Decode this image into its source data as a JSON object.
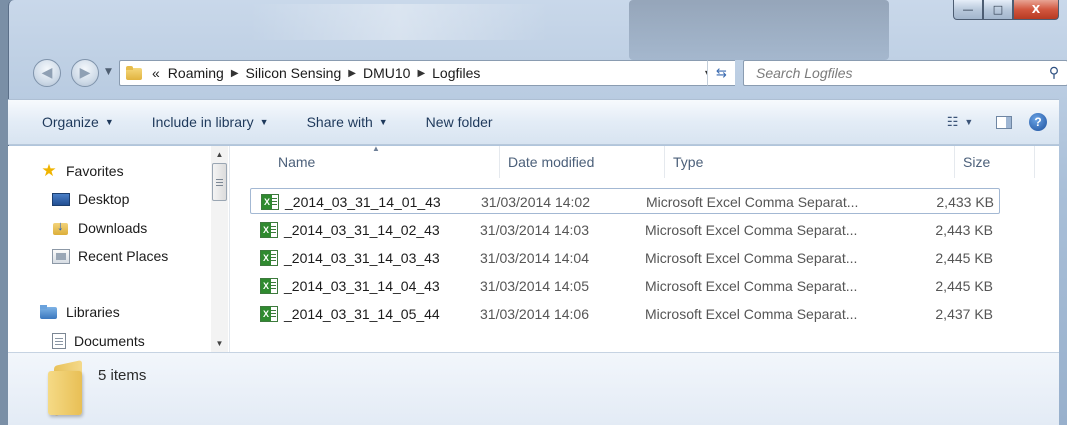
{
  "window": {
    "minimize_glyph": "—",
    "maximize_glyph": "□",
    "close_glyph": "X"
  },
  "address_bar": {
    "overflow_glyph": "«",
    "crumbs": [
      "Roaming",
      "Silicon Sensing",
      "DMU10",
      "Logfiles"
    ],
    "separator_glyph": "▶"
  },
  "search": {
    "placeholder": "Search Logfiles"
  },
  "toolbar": {
    "organize": "Organize",
    "include_in_library": "Include in library",
    "share_with": "Share with",
    "new_folder": "New folder"
  },
  "nav_pane": {
    "favorites": "Favorites",
    "desktop": "Desktop",
    "downloads": "Downloads",
    "recent_places": "Recent Places",
    "libraries": "Libraries",
    "documents": "Documents"
  },
  "columns": {
    "name": "Name",
    "date_modified": "Date modified",
    "type": "Type",
    "size": "Size"
  },
  "files": [
    {
      "name": "_2014_03_31_14_01_43",
      "date": "31/03/2014 14:02",
      "type": "Microsoft Excel Comma Separat...",
      "size": "2,433 KB",
      "selected": true
    },
    {
      "name": "_2014_03_31_14_02_43",
      "date": "31/03/2014 14:03",
      "type": "Microsoft Excel Comma Separat...",
      "size": "2,443 KB",
      "selected": false
    },
    {
      "name": "_2014_03_31_14_03_43",
      "date": "31/03/2014 14:04",
      "type": "Microsoft Excel Comma Separat...",
      "size": "2,445 KB",
      "selected": false
    },
    {
      "name": "_2014_03_31_14_04_43",
      "date": "31/03/2014 14:05",
      "type": "Microsoft Excel Comma Separat...",
      "size": "2,445 KB",
      "selected": false
    },
    {
      "name": "_2014_03_31_14_05_44",
      "date": "31/03/2014 14:06",
      "type": "Microsoft Excel Comma Separat...",
      "size": "2,437 KB",
      "selected": false
    }
  ],
  "details": {
    "item_count": "5 items"
  }
}
